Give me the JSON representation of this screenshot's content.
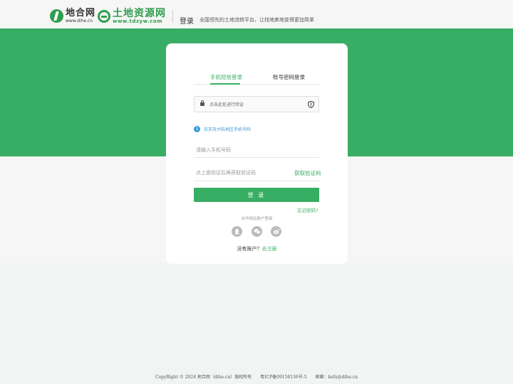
{
  "header": {
    "brand1_cn": "地合网",
    "brand1_en": "www.dihe.cn",
    "brand2_cn": "土地资源网",
    "brand2_en": "www.tdzyw.com",
    "page_label": "登录",
    "slogan": "全国领先的土地流转平台，让找地卖地变得更加简单"
  },
  "login": {
    "tabs": [
      {
        "label": "手机短信登录",
        "active": true
      },
      {
        "label": "账号密码登录",
        "active": false
      }
    ],
    "captcha_text": "点击此处进行验证",
    "notice": "仅支持大陆地区手机号码",
    "phone_placeholder": "请输入手机号码",
    "code_placeholder": "点上面验证后再获取验证码",
    "get_code": "获取验证码",
    "submit": "登 录",
    "forgot": "忘记密码?",
    "partner_label": "合作网站账户登录",
    "no_account": "没有账户？",
    "register": "去注册",
    "info_glyph": "i"
  },
  "footer": {
    "copyright": "CopyRight © 2024 地合网（dihe.cn）版权所有",
    "icp": "粤ICP备09158136号-5",
    "email": "邮箱：kefu@dihe.cn"
  },
  "colors": {
    "accent": "#38ae64",
    "info": "#3b9bd6",
    "icon_gray": "#bbbbbb"
  },
  "icons": [
    "logo-dihe-icon",
    "logo-tdzyw-icon",
    "lock-icon",
    "shield-icon",
    "info-icon",
    "qq-icon",
    "wechat-icon",
    "weibo-icon"
  ]
}
